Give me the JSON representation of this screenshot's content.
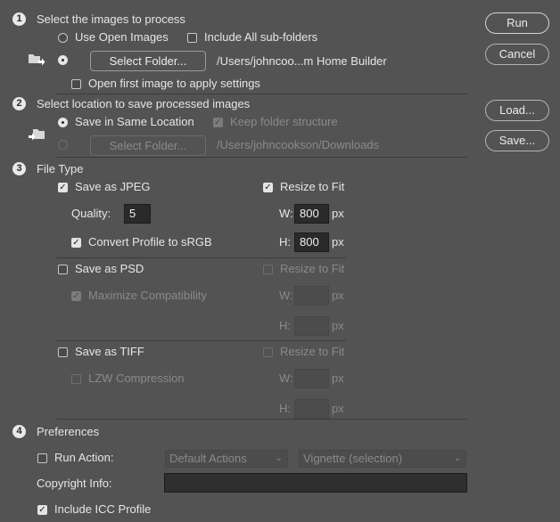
{
  "section1": {
    "number": "1",
    "title": "Select the images to process",
    "use_open_images": "Use Open Images",
    "include_subfolders": "Include All sub-folders",
    "select_folder_button": "Select Folder...",
    "folder_path": "/Users/johncoo...m Home Builder",
    "open_first_image": "Open first image to apply settings"
  },
  "section2": {
    "number": "2",
    "title": "Select location to save processed images",
    "save_same_location": "Save in Same Location",
    "keep_folder_structure": "Keep folder structure",
    "select_folder_button": "Select Folder...",
    "folder_path": "/Users/johncookson/Downloads"
  },
  "section3": {
    "number": "3",
    "title": "File Type",
    "jpeg": {
      "save_as": "Save as JPEG",
      "quality_label": "Quality:",
      "quality_value": "5",
      "convert_profile": "Convert Profile to sRGB",
      "resize_to_fit": "Resize to Fit",
      "w_label": "W:",
      "w_value": "800",
      "h_label": "H:",
      "h_value": "800",
      "unit": "px"
    },
    "psd": {
      "save_as": "Save as PSD",
      "maximize_compat": "Maximize Compatibility",
      "resize_to_fit": "Resize to Fit",
      "w_label": "W:",
      "h_label": "H:",
      "unit": "px"
    },
    "tiff": {
      "save_as": "Save as TIFF",
      "lzw": "LZW Compression",
      "resize_to_fit": "Resize to Fit",
      "w_label": "W:",
      "h_label": "H:",
      "unit": "px"
    }
  },
  "section4": {
    "number": "4",
    "title": "Preferences",
    "run_action": "Run Action:",
    "action_set": "Default Actions",
    "action": "Vignette (selection)",
    "copyright_label": "Copyright Info:",
    "copyright_value": "",
    "include_icc": "Include ICC Profile"
  },
  "buttons": {
    "run": "Run",
    "cancel": "Cancel",
    "load": "Load...",
    "save": "Save..."
  },
  "icons": {
    "folder_source": "folder-arrow-icon",
    "folder_dest": "folder-arrow-in-icon",
    "check": "✓",
    "chevron": "⌄"
  }
}
